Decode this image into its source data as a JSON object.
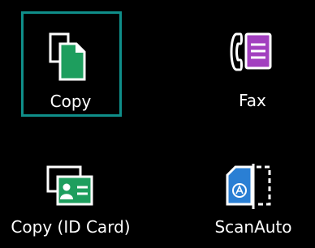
{
  "tiles": [
    {
      "id": "copy",
      "label": "Copy",
      "icon": "copy-icon",
      "selected": true
    },
    {
      "id": "fax",
      "label": "Fax",
      "icon": "fax-icon",
      "selected": false
    },
    {
      "id": "copy-id-card",
      "label": "Copy (ID Card)",
      "icon": "id-card-copy-icon",
      "selected": false
    },
    {
      "id": "scan-auto",
      "label": "ScanAuto",
      "icon": "scan-auto-icon",
      "selected": false
    }
  ],
  "colors": {
    "background": "#000000",
    "selection_border": "#0f8f8a",
    "copy_green": "#1e9e5e",
    "fax_purple": "#a23fbf",
    "id_green": "#1e9e5e",
    "scan_blue": "#2a7fd4",
    "label_text": "#ffffff"
  }
}
